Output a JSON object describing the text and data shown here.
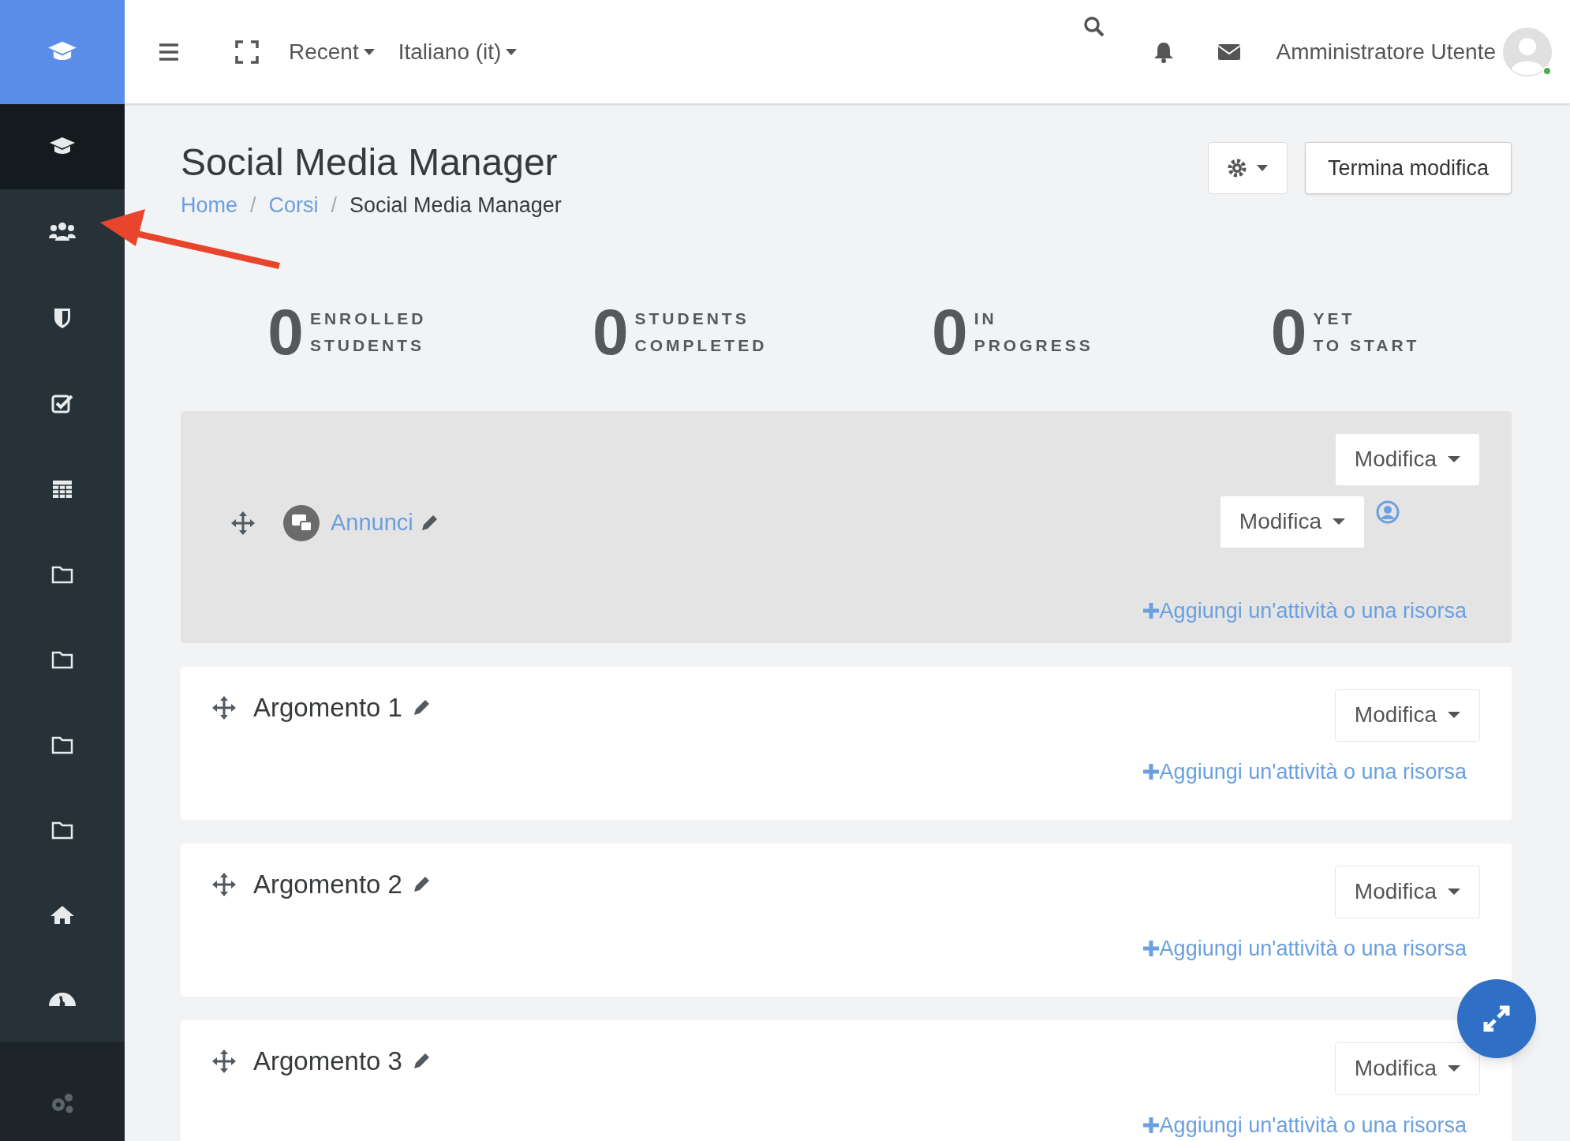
{
  "sidebar": {
    "items": [
      {
        "selected": true
      },
      {
        "selected": false
      },
      {
        "selected": false
      },
      {
        "selected": false
      },
      {
        "selected": false
      },
      {
        "selected": false
      },
      {
        "selected": false
      },
      {
        "selected": false
      },
      {
        "selected": false
      },
      {
        "selected": false
      },
      {
        "selected": false
      }
    ]
  },
  "navbar": {
    "menus": [
      "Recent",
      "Italiano (it)"
    ],
    "user_name": "Amministratore Utente",
    "online": true
  },
  "header": {
    "title": "Social Media Manager",
    "breadcrumb_separator": "/",
    "breadcrumb": [
      {
        "label": "Home",
        "kind": "link"
      },
      {
        "label": "Corsi",
        "kind": "link"
      },
      {
        "label": "Social Media Manager",
        "kind": "current"
      }
    ],
    "edit_button": "Termina modifica"
  },
  "stats": [
    {
      "value": "0",
      "label_1": "ENROLLED",
      "label_2": "STUDENTS"
    },
    {
      "value": "0",
      "label_1": "STUDENTS",
      "label_2": "COMPLETED"
    },
    {
      "value": "0",
      "label_1": "IN",
      "label_2": "PROGRESS"
    },
    {
      "value": "0",
      "label_1": "YET",
      "label_2": "TO START"
    }
  ],
  "sections": [
    {
      "kind": "general",
      "edit_button": "Modifica",
      "activities": [
        {
          "title": "Annunci",
          "edit_button": "Modifica"
        }
      ],
      "add_link": "Aggiungi un'attività o una risorsa"
    },
    {
      "kind": "topic",
      "title": "Argomento 1",
      "edit_button": "Modifica",
      "add_link": "Aggiungi un'attività o una risorsa"
    },
    {
      "kind": "topic",
      "title": "Argomento 2",
      "edit_button": "Modifica",
      "add_link": "Aggiungi un'attività o una risorsa"
    },
    {
      "kind": "topic",
      "title": "Argomento 3",
      "edit_button": "Modifica",
      "add_link": "Aggiungi un'attività o una risorsa"
    }
  ]
}
